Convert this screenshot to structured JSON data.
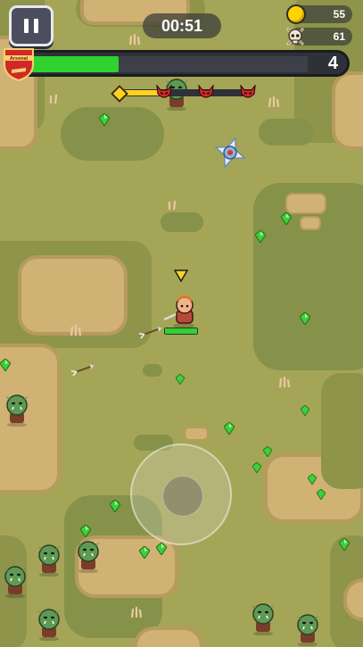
{
  "hud": {
    "timer": "00:51",
    "coins": "55",
    "kills": "61",
    "level": "4",
    "xp_progress": 0.32,
    "wave_progress": 0.33,
    "badge_text": "Arsenal",
    "wave_boss_count": 3,
    "pause_icon": "pause-icon",
    "coin_icon": "coin-icon",
    "kill_icon": "skull-icon"
  },
  "player": {
    "hp_progress": 1.0
  },
  "colors": {
    "xp": "#2fd22f",
    "wave": "#ffd21f",
    "gem": "#3fcf3a",
    "demon": "#e0262a"
  }
}
